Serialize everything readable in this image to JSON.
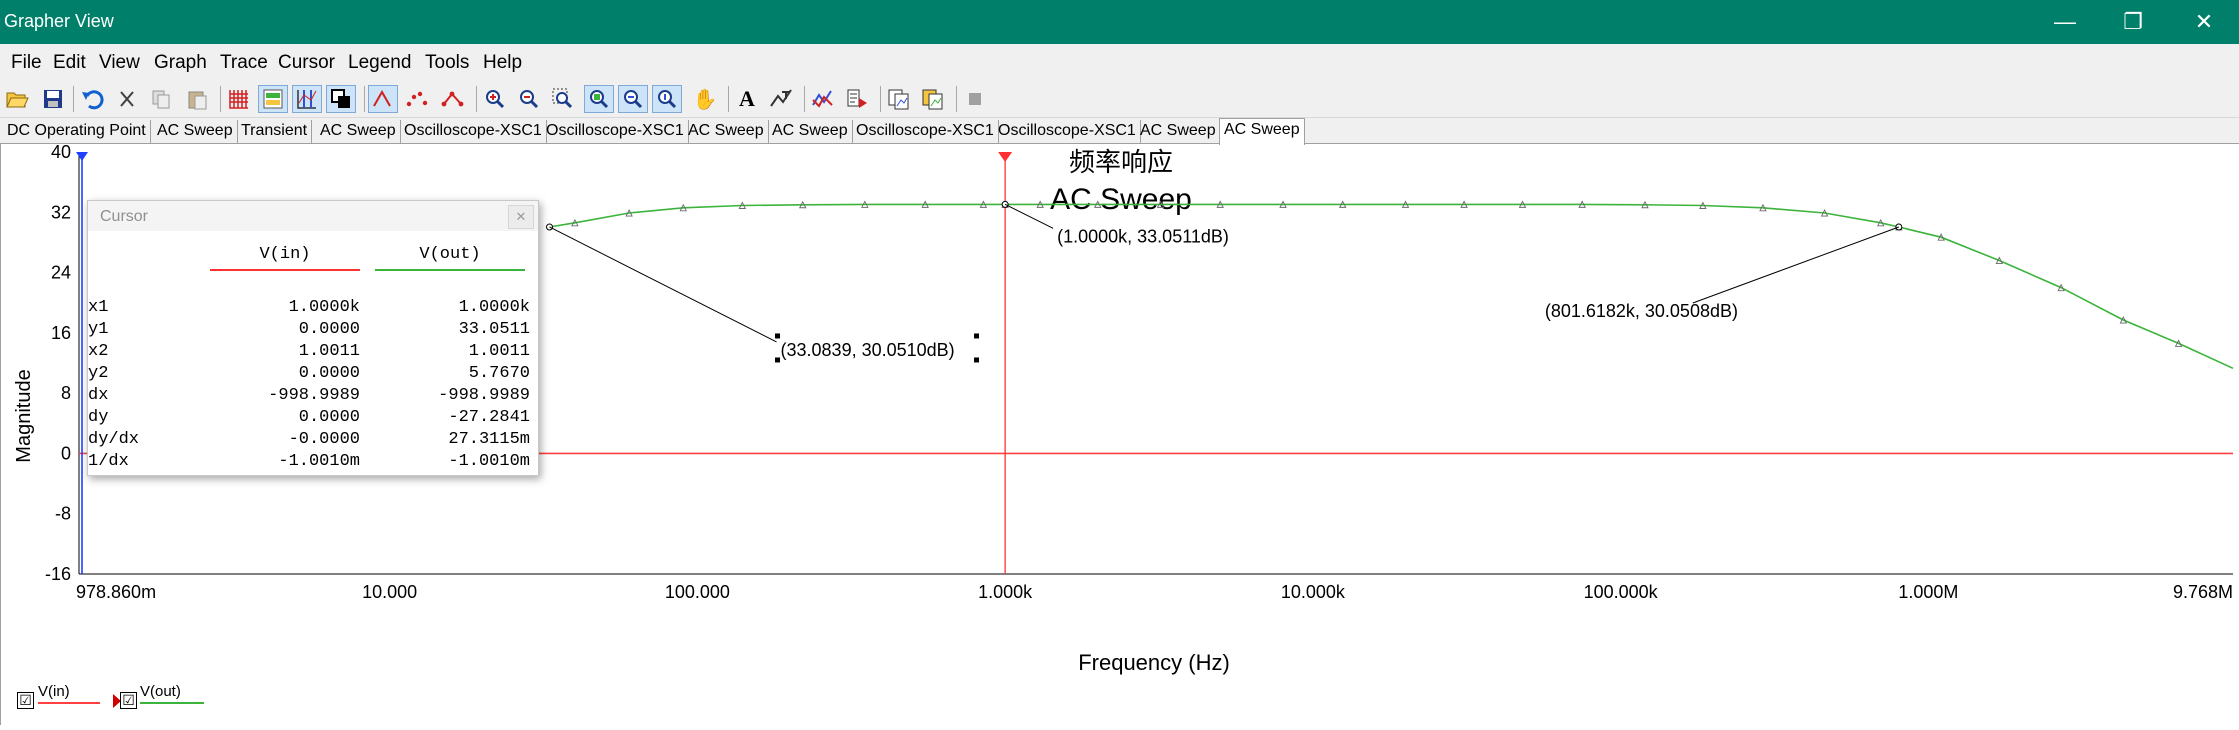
{
  "window": {
    "title": "Grapher View"
  },
  "menu": [
    "File",
    "Edit",
    "View",
    "Graph",
    "Trace",
    "Cursor",
    "Legend",
    "Tools",
    "Help"
  ],
  "tabs": [
    "DC Operating Point",
    "AC Sweep",
    "Transient",
    "AC Sweep",
    "Oscilloscope-XSC1",
    "Oscilloscope-XSC1",
    "AC Sweep",
    "AC Sweep",
    "Oscilloscope-XSC1",
    "Oscilloscope-XSC1",
    "AC Sweep",
    "AC Sweep"
  ],
  "active_tab_index": 11,
  "toolbar_icons": [
    "open-icon",
    "save-icon",
    "undo-icon",
    "cut-icon",
    "copy-icon",
    "paste-icon",
    "grid-icon",
    "legend-icon",
    "cursors-icon",
    "overlay-icon",
    "trace-icon",
    "points-icon",
    "trace-points-icon",
    "zoom-in-icon",
    "zoom-out-icon",
    "zoom-area-icon",
    "zoom-full-icon",
    "zoom-x-icon",
    "zoom-y-icon",
    "pan-icon",
    "text-icon",
    "label-icon",
    "export-icon",
    "properties-icon",
    "copy-graph-icon",
    "export-graph-icon",
    "stop-icon"
  ],
  "colors": {
    "titlebar": "#00806a",
    "vin": "#ff4040",
    "vout": "#3cb43c",
    "cursor": "#ff3030",
    "cursor2": "#2040ff"
  },
  "cursor_panel": {
    "title": "Cursor",
    "columns": [
      "V(in)",
      "V(out)"
    ],
    "rows": [
      {
        "label": "x1",
        "vin": "1.0000k",
        "vout": "1.0000k"
      },
      {
        "label": "y1",
        "vin": "0.0000",
        "vout": "33.0511"
      },
      {
        "label": "x2",
        "vin": "1.0011",
        "vout": "1.0011"
      },
      {
        "label": "y2",
        "vin": "0.0000",
        "vout": "5.7670"
      },
      {
        "label": "dx",
        "vin": "-998.9989",
        "vout": "-998.9989"
      },
      {
        "label": "dy",
        "vin": "0.0000",
        "vout": "-27.2841"
      },
      {
        "label": "dy/dx",
        "vin": "-0.0000",
        "vout": "27.3115m"
      },
      {
        "label": "1/dx",
        "vin": "-1.0010m",
        "vout": "-1.0010m"
      }
    ]
  },
  "chart_data": {
    "type": "line",
    "title": "频率响应",
    "subtitle": "AC Sweep",
    "xlabel": "Frequency (Hz)",
    "ylabel": "Magnitude",
    "xscale": "log",
    "xlim": [
      0.97886,
      9768000
    ],
    "ylim": [
      -16,
      40
    ],
    "xticks": [
      0.97886,
      10,
      100,
      1000,
      10000,
      100000,
      1000000,
      9768000
    ],
    "xtick_labels": [
      "978.860m",
      "10.000",
      "100.000",
      "1.000k",
      "10.000k",
      "100.000k",
      "1.000M",
      "9.768M"
    ],
    "yticks": [
      -16,
      -8,
      0,
      8,
      16,
      24,
      32,
      40
    ],
    "ytick_labels": [
      "-16",
      "-8",
      "0",
      "8",
      "16",
      "24",
      "32",
      "40"
    ],
    "series": [
      {
        "name": "V(in)",
        "x": [
          0.97886,
          9768000
        ],
        "y": [
          0,
          0
        ]
      },
      {
        "name": "V(out)",
        "x": [
          33.08,
          40,
          60,
          90,
          140,
          220,
          350,
          550,
          850,
          1000,
          1300,
          2000,
          3200,
          5000,
          8000,
          12500,
          20000,
          31000,
          48000,
          75000,
          120000,
          185000,
          290000,
          460000,
          700000,
          801618,
          1100000,
          1700000,
          2700000,
          4300000,
          6500000,
          9768000
        ],
        "y": [
          30.05,
          30.6,
          31.9,
          32.6,
          32.9,
          33.0,
          33.04,
          33.05,
          33.05,
          33.051,
          33.05,
          33.05,
          33.05,
          33.05,
          33.05,
          33.05,
          33.05,
          33.05,
          33.05,
          33.05,
          33.0,
          32.9,
          32.6,
          31.9,
          30.6,
          30.05,
          28.7,
          25.6,
          22.0,
          17.7,
          14.6,
          11.3
        ]
      }
    ],
    "cursors": [
      {
        "x": 1000
      },
      {
        "x": 1.0011
      }
    ],
    "annotations": [
      {
        "text": "(1.0000k, 33.0511dB)",
        "x": 1000,
        "y": 33.0511
      },
      {
        "text": "(33.0839, 30.0510dB)",
        "x": 33.0839,
        "y": 30.051
      },
      {
        "text": "(801.6182k, 30.0508dB)",
        "x": 801618,
        "y": 30.0508
      }
    ]
  },
  "legend": {
    "items": [
      {
        "label": "V(in)",
        "checked": "☑"
      },
      {
        "label": "V(out)",
        "checked": "☑"
      }
    ]
  }
}
